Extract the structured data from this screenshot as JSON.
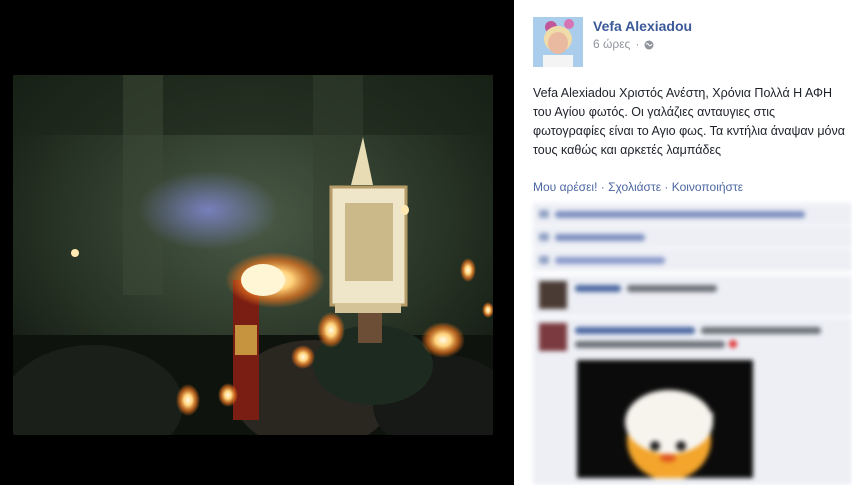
{
  "post": {
    "author": "Vefa Alexiadou",
    "time": "6 ώρες",
    "separator": "·",
    "text": "Vefa Alexiadou Χριστός Ανέστη, Χρόνια Πολλά Η ΑΦΗ του Αγίου φωτός. Οι γαλάζιες ανταυγιες στις φωτογραφίες είναι το Αγιο φως. Τα κντήλια άναψαν μόνα τους καθώς και αρκετές λαμπάδες"
  },
  "actions": {
    "like": "Μου αρέσει!",
    "comment": "Σχολιάστε",
    "share": "Κοινοποιήστε",
    "sep": " · "
  },
  "icons": {
    "audience": "globe-icon",
    "likes": "thumbs-up-icon",
    "comments": "comment-icon",
    "shares": "share-icon"
  },
  "colors": {
    "link": "#3b5998",
    "panel": "#edeff5",
    "meta": "#90949c"
  }
}
